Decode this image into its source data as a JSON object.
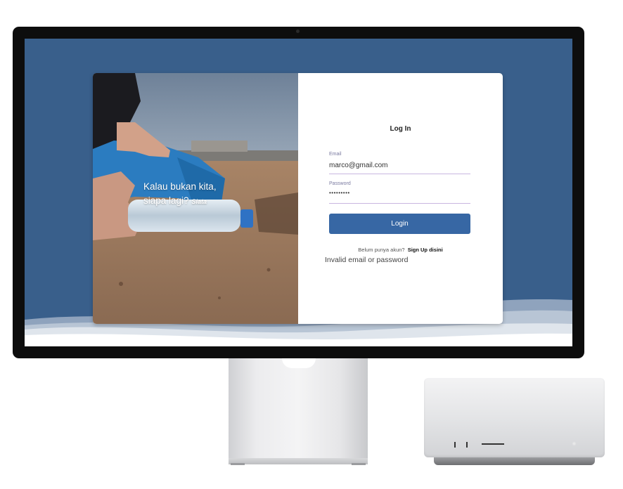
{
  "photo": {
    "tagline_line1": "Kalau bukan kita,",
    "tagline_line2": "siapa lagi?",
    "brand": "Siata"
  },
  "form": {
    "title": "Log In",
    "email_label": "Email",
    "email_value": "marco@gmail.com",
    "password_label": "Password",
    "password_value": "•••••••••",
    "login_button": "Login",
    "signup_prompt": "Belum punya akun?",
    "signup_link": "Sign Up disini",
    "error_message": "Invalid email or password"
  },
  "colors": {
    "screen_background": "#395f8b",
    "button": "#3767a4",
    "field_underline": "#c9b6e0"
  },
  "icons": [
    "plastic-bottle-photo",
    "monitor-camera-icon"
  ]
}
